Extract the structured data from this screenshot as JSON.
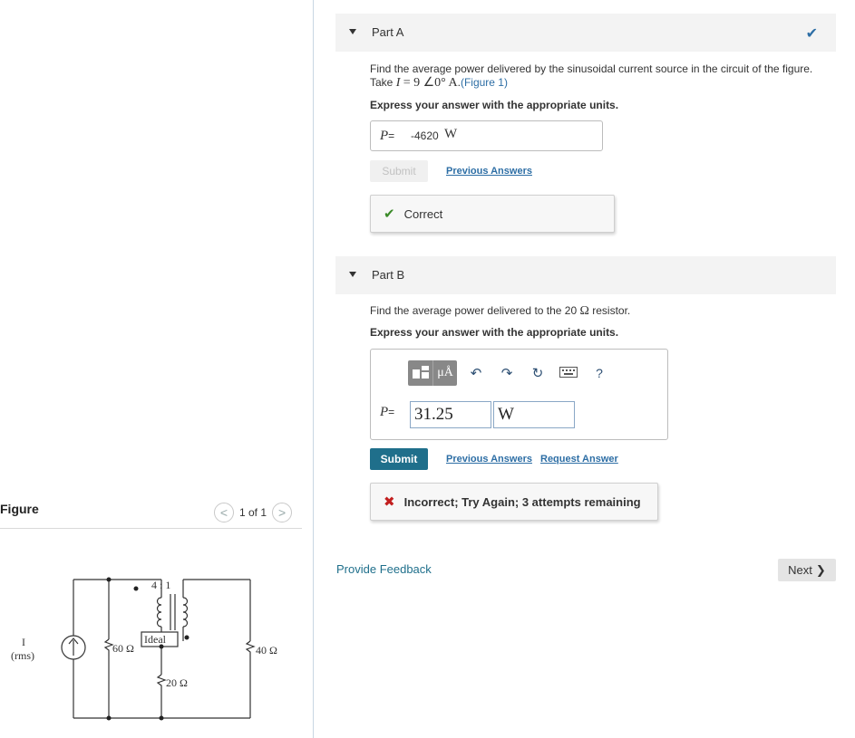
{
  "figure": {
    "title": "Figure",
    "pager_text": "1 of 1",
    "prev_glyph": "<",
    "next_glyph": ">",
    "labels": {
      "source": "I",
      "rms": "(rms)",
      "r60": "60 Ω",
      "ratio": "4 : 1",
      "ideal": "Ideal",
      "r20": "20 Ω",
      "r40": "40 Ω"
    }
  },
  "partA": {
    "label": "Part A",
    "status_icon": "checkmark-icon",
    "question_line1": "Find the average power delivered by the sinusoidal current source in the circuit of the figure.",
    "question_take": "Take",
    "question_var": "I",
    "question_val": "= 9 ∠0° A",
    "question_suffix": ".",
    "figure_link": "(Figure 1)",
    "instruction": "Express your answer with the appropriate units.",
    "answer_var": "P",
    "answer_eq": "=",
    "answer_value": "-4620",
    "answer_unit": "W",
    "submit_label": "Submit",
    "previous_answers": "Previous Answers",
    "feedback": "Correct"
  },
  "partB": {
    "label": "Part B",
    "question_before": "Find the average power delivered to the 20",
    "question_ohm": "Ω",
    "question_after": "resistor.",
    "instruction": "Express your answer with the appropriate units.",
    "toolbar": {
      "units_label": "μÅ",
      "help": "?"
    },
    "answer_var": "P",
    "answer_eq": "=",
    "answer_value": "31.25",
    "answer_unit": "W",
    "submit_label": "Submit",
    "previous_answers": "Previous Answers",
    "request_answer": "Request Answer",
    "feedback": "Incorrect; Try Again; 3 attempts remaining"
  },
  "footer": {
    "provide_feedback": "Provide Feedback",
    "next": "Next"
  },
  "colors": {
    "accent": "#2d6ea5",
    "submit": "#1f6f8b",
    "correct": "#3a8a28",
    "incorrect": "#c21f1f"
  }
}
